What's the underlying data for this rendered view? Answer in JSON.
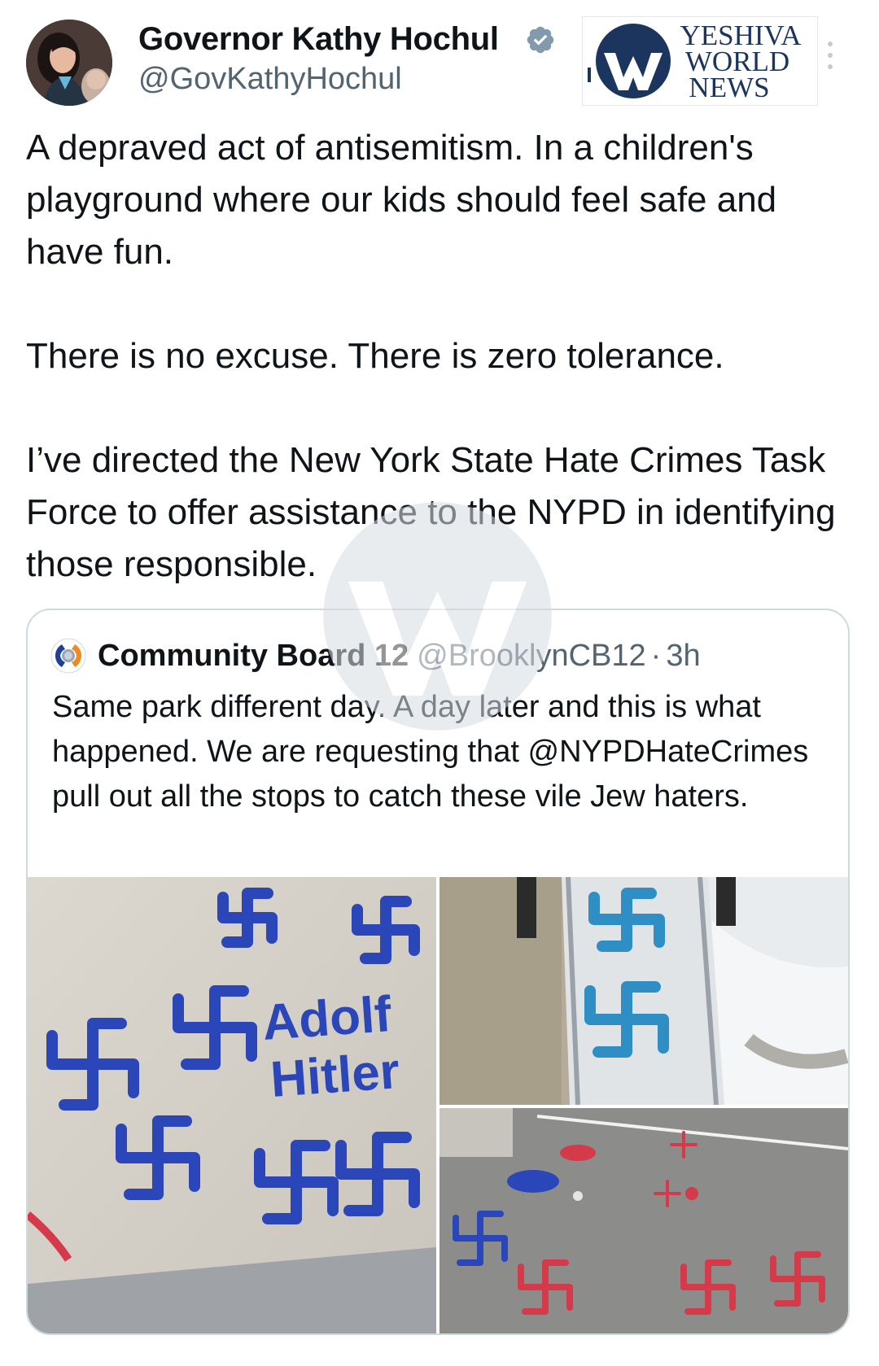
{
  "tweet": {
    "author_name": "Governor Kathy Hochul",
    "author_handle": "@GovKathyHochul",
    "paragraphs": [
      "A depraved act of antisemitism. In a children's playground where our kids should feel safe and have fun.",
      "There is no excuse. There is zero tolerance.",
      "I’ve directed the New York State Hate Crimes Task Force to offer assistance to the NYPD in identifying those responsible."
    ]
  },
  "logo": {
    "line1": "YESHIVA",
    "line2": "WORLD",
    "line3": "NEWS",
    "color": "#1c355e"
  },
  "quoted_tweet": {
    "author_name": "Community Board 12",
    "author_handle": "@BrooklynCB12",
    "separator": "·",
    "time": "3h",
    "text": "Same park different day. A day later and this is what happened. We are requesting that @NYPDHateCrimes pull out all the stops to catch these vile Jew haters.",
    "photo_text": {
      "line1": "Adolf",
      "line2": "Hitler"
    }
  },
  "colors": {
    "text_primary": "#0f1419",
    "text_secondary": "#536471",
    "verified_badge": "#829aab",
    "card_border": "#cfd9de",
    "graffiti_blue": "#2a46b8",
    "graffiti_red": "#d43a4a"
  },
  "icons": {
    "verified": "verified-badge-icon",
    "more": "more-vertical-icon",
    "watermark": "ywn-watermark-icon"
  }
}
